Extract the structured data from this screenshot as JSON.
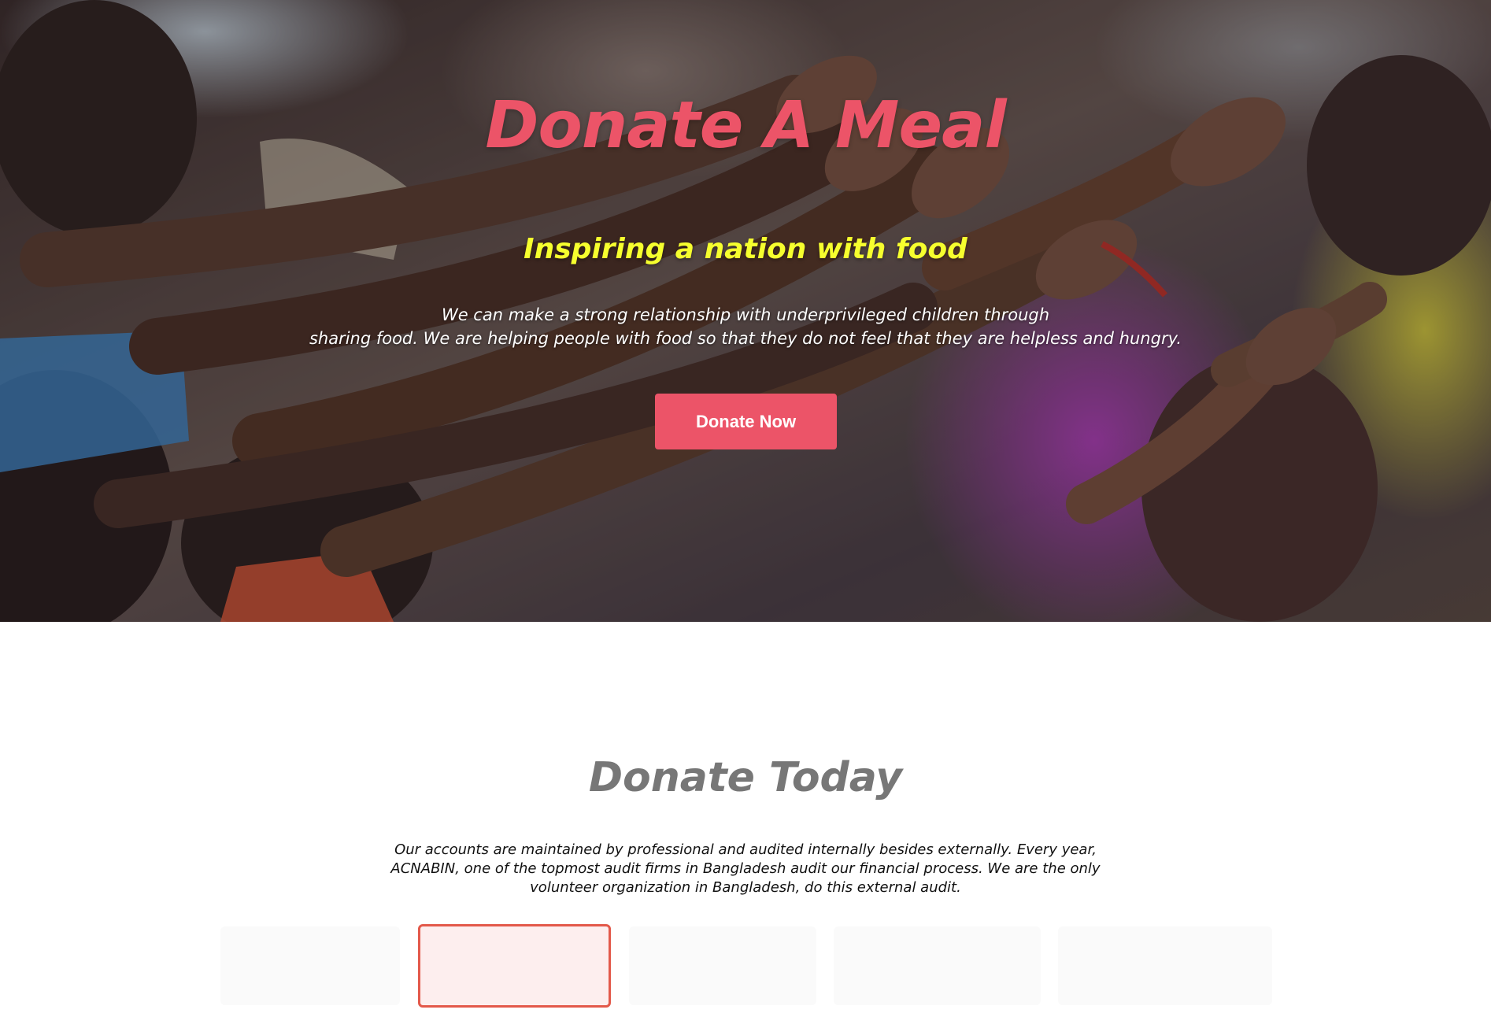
{
  "hero": {
    "title": "Donate A Meal",
    "subtitle": "Inspiring a nation with food",
    "description_lines": [
      "We can make a strong relationship with underprivileged children through",
      "sharing food. We are helping people with food so that they do not feel that they are helpless and hungry."
    ],
    "cta_label": "Donate Now"
  },
  "donate_section": {
    "title": "Donate Today",
    "text_lines": [
      "Our accounts are maintained by professional and audited internally besides externally. Every year,",
      "ACNABIN, one of the topmost audit firms in Bangladesh audit our financial process. We are the only",
      "volunteer organization in Bangladesh, do this external audit."
    ],
    "amount_options": [
      {
        "selected": false
      },
      {
        "selected": true
      },
      {
        "selected": false
      },
      {
        "selected": false
      },
      {
        "selected": false
      }
    ]
  },
  "colors": {
    "accent": "#ec5468",
    "subtitle": "#f6ff2e",
    "section_title": "#777777",
    "selected_border": "#e3594a",
    "selected_fill": "#fdeeee",
    "card_fill": "#fafafa"
  }
}
